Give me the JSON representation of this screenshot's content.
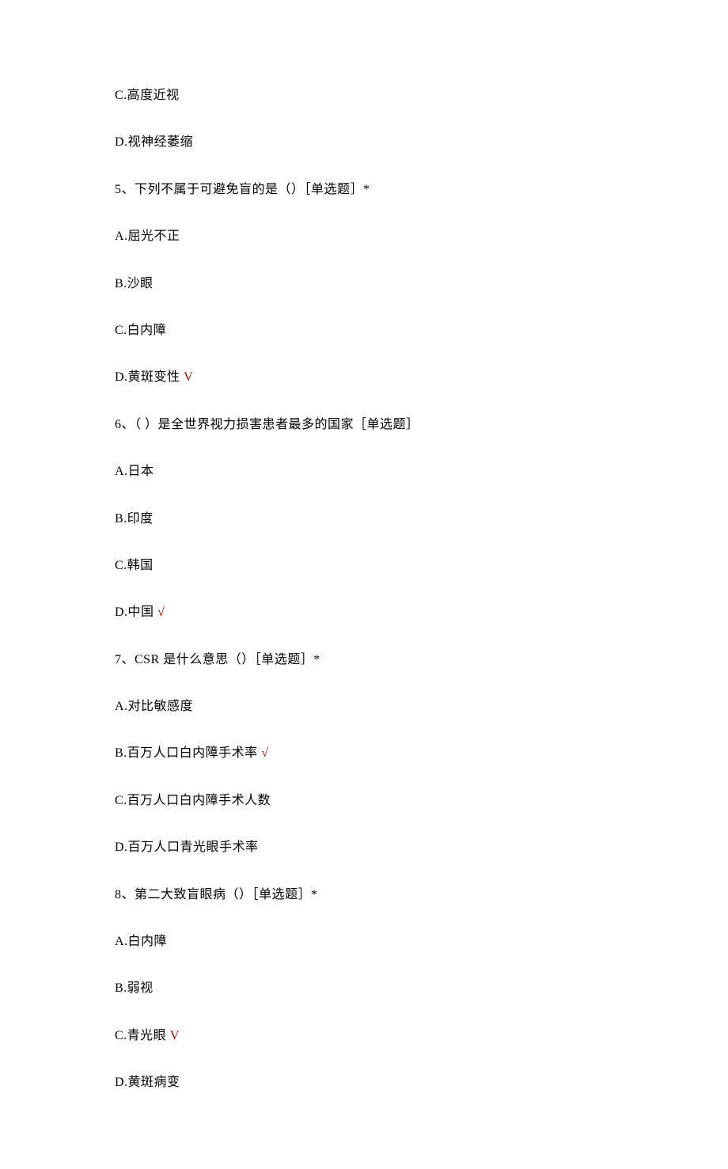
{
  "lines": {
    "l1": "C.高度近视",
    "l2": "D.视神经萎缩",
    "l3": "5、下列不属于可避免盲的是（）［单选题］*",
    "l4": "A.屈光不正",
    "l5": "B.沙眼",
    "l6": "C.白内障",
    "l7_text": "D.黄斑变性 ",
    "l7_mark": "V",
    "l8": "6、（ ）是全世界视力损害患者最多的国家［单选题］",
    "l9": "A.日本",
    "l10": "B.印度",
    "l11": "C.韩国",
    "l12_text": "D.中国 ",
    "l12_mark": "√",
    "l13": "7、CSR 是什么意思（）［单选题］*",
    "l14": "A.对比敏感度",
    "l15_text": "B.百万人口白内障手术率 ",
    "l15_mark": "√",
    "l16": "C.百万人口白内障手术人数",
    "l17": "D.百万人口青光眼手术率",
    "l18": "8、第二大致盲眼病（）［单选题］*",
    "l19": "A.白内障",
    "l20": "B.弱视",
    "l21_text": "C.青光眼 ",
    "l21_mark": "V",
    "l22": "D.黄斑病变"
  }
}
